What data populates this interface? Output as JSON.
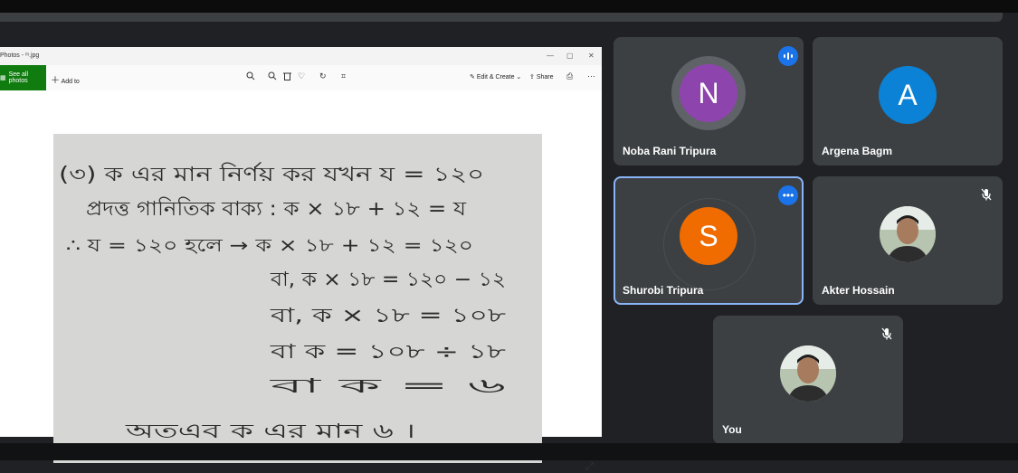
{
  "photos_window": {
    "title": "Photos - ᵐ.jpg",
    "see_all_label": "See all photos",
    "add_to_label": "Add to",
    "edit_create_label": "Edit & Create",
    "share_label": "Share",
    "minimize_glyph": "—",
    "maximize_glyph": "▢",
    "close_glyph": "✕",
    "icons": [
      "zoom-in-icon",
      "zoom-out-icon",
      "delete-icon",
      "favorite-icon",
      "rotate-icon",
      "crop-icon",
      "edit-create-icon",
      "share-icon",
      "print-icon",
      "more-icon",
      "expand-icon"
    ]
  },
  "participants": [
    {
      "name": "Noba Rani Tripura",
      "initial": "N",
      "color": "#8e44ad",
      "state": "speaking"
    },
    {
      "name": "Argena Bagm",
      "initial": "A",
      "color": "#0b82d6",
      "state": "none"
    },
    {
      "name": "Shurobi Tripura",
      "initial": "S",
      "color": "#f06c00",
      "state": "more-options",
      "highlighted": true
    },
    {
      "name": "Akter Hossain",
      "state": "muted",
      "has_photo": true
    },
    {
      "name": "You",
      "state": "muted",
      "has_photo": true
    }
  ],
  "handwriting": [
    "(৩) ক এর মান নির্ণয় কর যখন য = ১২০",
    "প্রদত্ত গানিতিক বাক্য : ক × ১৮ + ১২ = য",
    "∴ য = ১২০ হলে → ক × ১৮ + ১২ = ১২০",
    "বা, ক × ১৮ = ১২০ − ১২",
    "বা, ক × ১৮ = ১০৮",
    "বা ক = ১০৮ ÷ ১৮",
    "বা ক = ৬",
    "অতএব ক এর মান ৬ ।"
  ],
  "colors": {
    "accent": "#1a73e8",
    "tile_bg": "#3c4043",
    "page_bg": "#202124",
    "highlight_border": "#8ab4f8"
  }
}
